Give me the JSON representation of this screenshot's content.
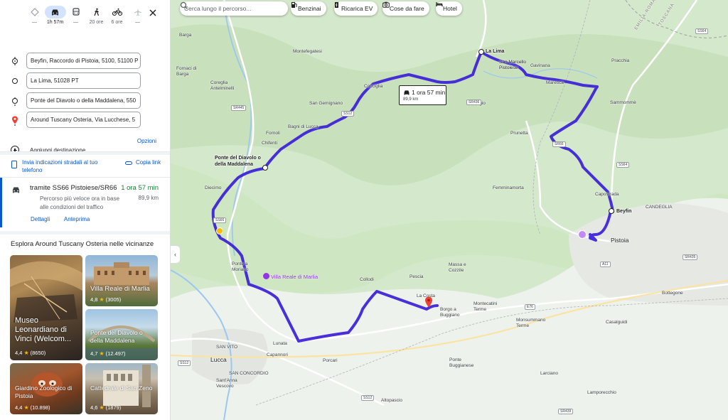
{
  "travel_modes": [
    {
      "name": "best",
      "label": "—"
    },
    {
      "name": "car",
      "label": "1h 57m",
      "active": true
    },
    {
      "name": "transit",
      "label": "—"
    },
    {
      "name": "walk",
      "label": "20 ore"
    },
    {
      "name": "bike",
      "label": "6 ore"
    },
    {
      "name": "flight",
      "label": "—"
    }
  ],
  "stops": [
    {
      "value": "Beyfin, Raccordo di Pistoia, 5100, 51100 P"
    },
    {
      "value": "La Lima, 51028 PT"
    },
    {
      "value": "Ponte del Diavolo o della Maddalena, 550"
    },
    {
      "value": "Around Tuscany Osteria, Via Lucchese, 5"
    }
  ],
  "add_destination": "Aggiungi destinazione",
  "options_label": "Opzioni",
  "send_to_phone": "Invia indicazioni stradali al tuo telefono",
  "copy_link": "Copia link",
  "route": {
    "name": "tramite SS66 Pistoiese/SR66",
    "time": "1 ora 57 min",
    "distance": "89,9 km",
    "description": "Percorso più veloce ora in base alle condizioni del traffico",
    "details_label": "Dettagli",
    "preview_label": "Anteprima"
  },
  "explore_title": "Esplora Around Tuscany Osteria nelle vicinanze",
  "places": [
    {
      "name": "Museo Leonardiano di Vinci (Welcom...",
      "rating": "4,4",
      "reviews": "(8650)"
    },
    {
      "name": "Villa Reale di Marlia",
      "rating": "4,8",
      "reviews": "(3005)"
    },
    {
      "name": "Ponte del Diavolo o della Maddalena",
      "rating": "4,7",
      "reviews": "(12.497)"
    },
    {
      "name": "Giardino Zoologico di Pistoia",
      "rating": "4,4",
      "reviews": "(10.898)"
    },
    {
      "name": "Cattedrale di San Zeno",
      "rating": "4,6",
      "reviews": "(1879)"
    }
  ],
  "map": {
    "search_placeholder": "Cerca lungo il percorso...",
    "chips": [
      "Benzinai",
      "Ricarica EV",
      "Cose da fare",
      "Hotel"
    ],
    "callout_time": "1 ora 57 min",
    "callout_distance": "89,9 km",
    "waypoints": {
      "la_lima": "La Lima",
      "beyfin": "Beyfin",
      "ponte": "Ponte del Diavolo o della Maddalena"
    },
    "towns": {
      "pistoia": "Pistoia",
      "lucca": "Lucca",
      "collodi": "Collodi",
      "pescia": "Pescia",
      "marlia_poi": "Villa Reale di Marlia",
      "montecatini": "Montecatini Terme",
      "borgo": "Borgo a Buggiano",
      "altopascio": "Altopascio",
      "lamporecchio": "Lamporecchio",
      "capannori": "Capannori",
      "barga": "Barga",
      "montefegatesi": "Montefegatesi",
      "san_gemignano": "San Gemignano",
      "cocciglia": "Cocciglia",
      "bagni": "Bagni di Lucca",
      "fornoli": "Fornoli",
      "chifenti": "Chifenti",
      "diecimo": "Diecimo",
      "ponte_moriano": "Ponte a Moriano",
      "pitegio": "Pitegio",
      "prunetta": "Prunetta",
      "femminamorta": "Femminamorta",
      "gavinana": "Gavinana",
      "san_marcello": "San Marcello Pistoiese",
      "maresca": "Maresca",
      "sammomme": "Sammommè",
      "pracchia": "Pracchia",
      "capostrada": "Capostrada",
      "candeglia": "CANDEGLIA",
      "bottegone": "Bottegone",
      "casalguidi": "Casalguidi",
      "monsummano": "Monsummano Terme",
      "ponte_buggianese": "Ponte Buggianese",
      "massa_cozzile": "Massa e Cozzile",
      "la_costa": "La Costa",
      "porcari": "Porcari",
      "lunata": "Lunata",
      "san_vito": "SAN VITO",
      "san_concordio": "SAN CONCORDIO",
      "sant_vescovo": "Sant'Anna Vescovo",
      "fornaci_barga": "Fornaci di Barga",
      "coreglia": "Coreglia Antelminelli",
      "larciano": "Larciano",
      "emilia": "EMILIA-ROMAGNA",
      "toscana": "TOSCANA"
    },
    "roads": [
      "SS64",
      "SR445",
      "SS12",
      "SR66",
      "SS64",
      "SS66",
      "SR435",
      "SR436",
      "A11",
      "E76",
      "SS12",
      "SS12",
      "SR439"
    ]
  }
}
